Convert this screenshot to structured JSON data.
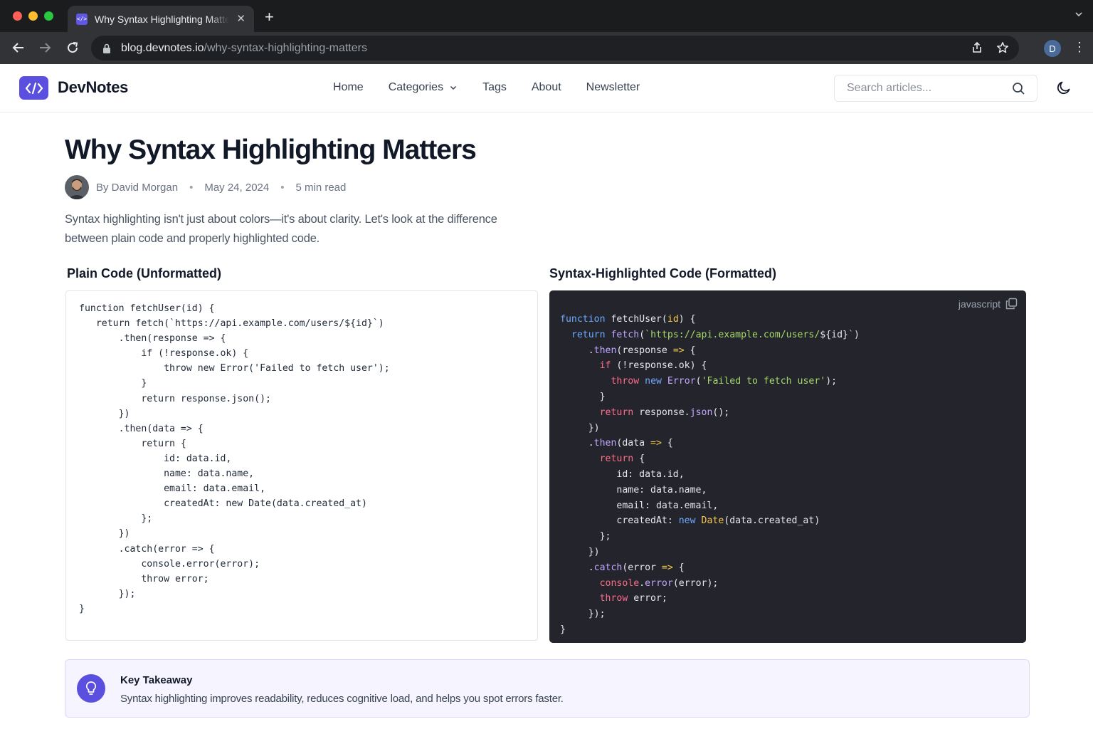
{
  "browser": {
    "tab_title": "Why Syntax Highlighting Matters",
    "tab_favicon": "</>",
    "url_domain": "blog.devnotes.io",
    "url_path": "/why-syntax-highlighting-matters",
    "profile_initial": "D"
  },
  "header": {
    "logo_glyph": "</>",
    "brand": "DevNotes",
    "nav": [
      "Home",
      "Categories",
      "Tags",
      "About",
      "Newsletter"
    ],
    "search_placeholder": "Search articles...",
    "accent_color": "#5b4fe0"
  },
  "article": {
    "title": "Why Syntax Highlighting Matters",
    "author": "By David Morgan",
    "date": "May 24, 2024",
    "read_time": "5 min read",
    "lead": "Syntax highlighting isn't just about colors—it's about clarity. Let's look at the difference between plain code and properly highlighted code."
  },
  "plain_section": {
    "title": "Plain Code (Unformatted)",
    "code": "function fetchUser(id) {\n   return fetch(`https://api.example.com/users/${id}`)\n       .then(response => {\n           if (!response.ok) {\n               throw new Error('Failed to fetch user');\n           }\n           return response.json();\n       })\n       .then(data => {\n           return {\n               id: data.id,\n               name: data.name,\n               email: data.email,\n               createdAt: new Date(data.created_at)\n           };\n       })\n       .catch(error => {\n           console.error(error);\n           throw error;\n       });\n}"
  },
  "highlighted_section": {
    "title": "Syntax-Highlighted Code (Formatted)",
    "language": "javascript",
    "colors": {
      "background": "#24252c",
      "keyword": "#6ea8ff",
      "function": "#c3a6ff",
      "string": "#a5d86b",
      "control": "#ff6b8a",
      "class": "#f5c64e"
    }
  },
  "takeaway": {
    "title": "Key Takeaway",
    "text": "Syntax highlighting improves readability, reduces cognitive load, and helps you spot errors faster."
  }
}
